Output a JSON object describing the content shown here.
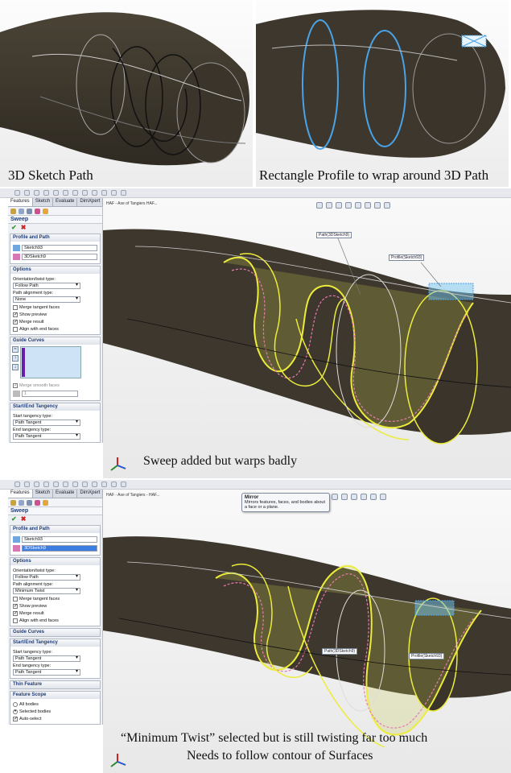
{
  "top_left": {
    "caption": "3D Sketch Path"
  },
  "top_right": {
    "caption": "Rectangle Profile to wrap around 3D Path"
  },
  "panel1": {
    "tabs": [
      "Features",
      "Sketch",
      "Evaluate",
      "DimXpert"
    ],
    "feature_title": "Sweep",
    "profile_path": {
      "header": "Profile and Path",
      "profile_value": "Sketch93",
      "path_value": "3DSketch9"
    },
    "options": {
      "header": "Options",
      "orientation_label": "Orientation/twist type:",
      "orientation_value": "Follow Path",
      "alignment_label": "Path alignment type:",
      "alignment_value": "None",
      "merge_tangent": "Merge tangent faces",
      "show_preview": "Show preview",
      "merge_result": "Merge result",
      "align_end": "Align with end faces"
    },
    "guide_curves": {
      "header": "Guide Curves",
      "merge_smooth": "Merge smooth faces",
      "spin_value": "1"
    },
    "tangency": {
      "header": "Start/End Tangency",
      "start_label": "Start tangency type:",
      "start_value": "Path Tangent",
      "end_label": "End tangency type:",
      "end_value": "Path Tangent"
    },
    "tree_label": "HAF - Axe of Tangiers HAF...",
    "callout_path": "Path(3DSketch9)",
    "callout_profile": "Profile(Sketch93)",
    "caption": "Sweep added but warps badly"
  },
  "panel2": {
    "tabs": [
      "Features",
      "Sketch",
      "Evaluate",
      "DimXpert"
    ],
    "feature_title": "Sweep",
    "profile_path": {
      "header": "Profile and Path",
      "profile_value": "Sketch93",
      "path_value": "3DSketch9"
    },
    "options": {
      "header": "Options",
      "orientation_label": "Orientation/twist type:",
      "orientation_value": "Follow Path",
      "alignment_label": "Path alignment type:",
      "alignment_value": "Minimum Twist",
      "merge_tangent": "Merge tangent faces",
      "show_preview": "Show preview",
      "merge_result": "Merge result",
      "align_end": "Align with end faces"
    },
    "guide_curves": {
      "header": "Guide Curves"
    },
    "tangency": {
      "header": "Start/End Tangency",
      "start_label": "Start tangency type:",
      "start_value": "Path Tangent",
      "end_label": "End tangency type:",
      "end_value": "Path Tangent"
    },
    "thin_feature": {
      "header": "Thin Feature"
    },
    "feature_scope": {
      "header": "Feature Scope",
      "all_bodies": "All bodies",
      "selected_bodies": "Selected bodies",
      "auto_select": "Auto-select"
    },
    "tree_label": "HAF - Axe of Tangiers - HAF...",
    "tooltip_title": "Mirror",
    "tooltip_body": "Mirrors features, faces, and bodies about a face or a plane.",
    "callout_path": "Path(3DSketch9)",
    "callout_profile": "Profile(Sketch93)",
    "caption_line1": "“Minimum Twist” selected but is still twisting far too much",
    "caption_line2": "Needs to follow contour of Surfaces"
  },
  "colors": {
    "body": "#3d372d",
    "preview": "#ecec3a",
    "path": "#e87ab0",
    "sketch": "#4aa3e6"
  }
}
